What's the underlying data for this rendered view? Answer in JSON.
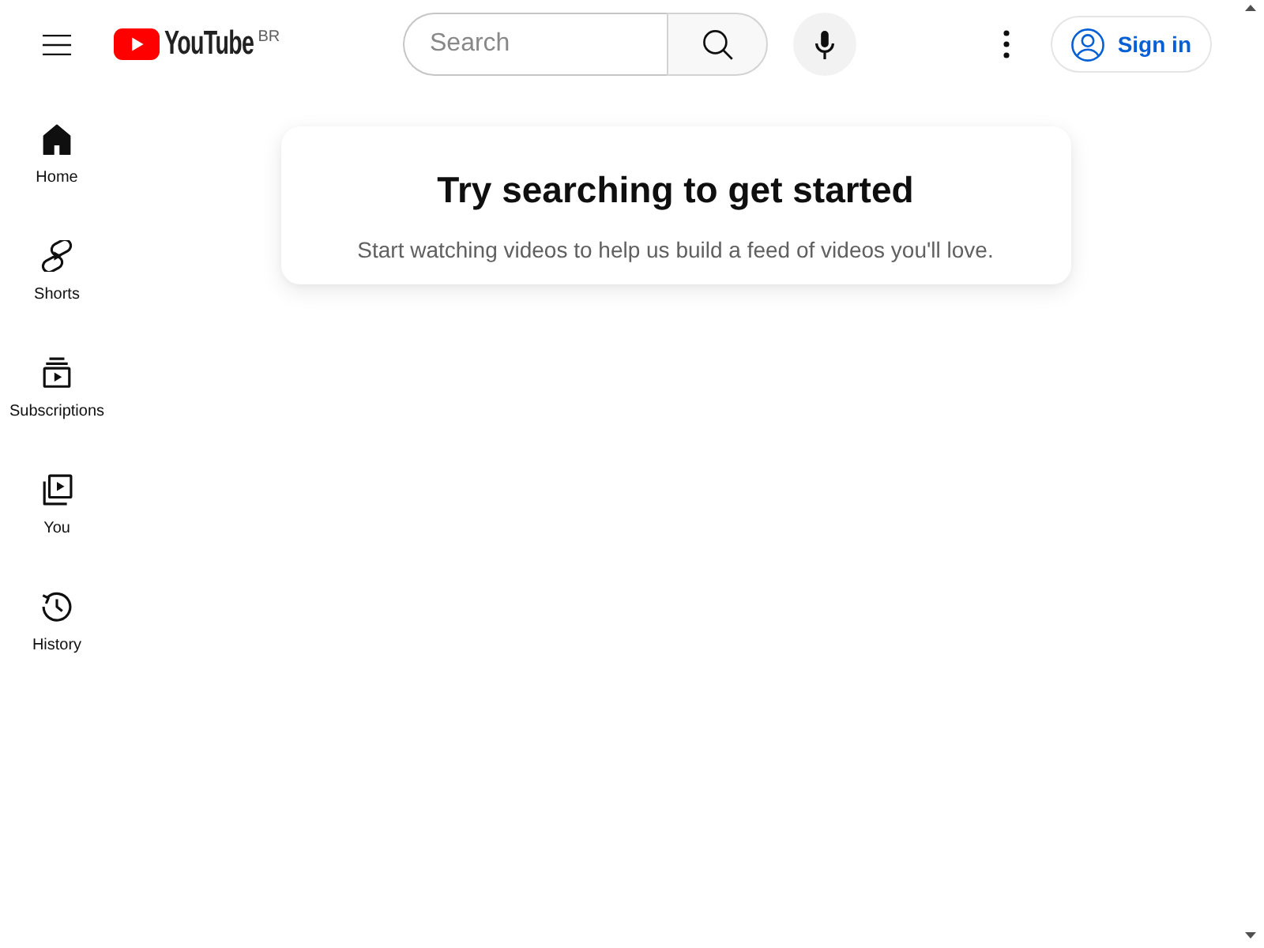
{
  "header": {
    "logo": {
      "wordmark": "YouTube",
      "country_code": "BR"
    },
    "search": {
      "placeholder": "Search"
    },
    "sign_in_button": {
      "label": "Sign in"
    }
  },
  "sidebar": {
    "items": [
      {
        "label": "Home",
        "selected": true
      },
      {
        "label": "Shorts",
        "selected": false
      },
      {
        "label": "Subscriptions",
        "selected": false
      },
      {
        "label": "You",
        "selected": false
      },
      {
        "label": "History",
        "selected": false
      }
    ]
  },
  "card": {
    "title": "Try searching to get started",
    "message": "Start watching videos to help us build a feed of videos you'll love."
  }
}
